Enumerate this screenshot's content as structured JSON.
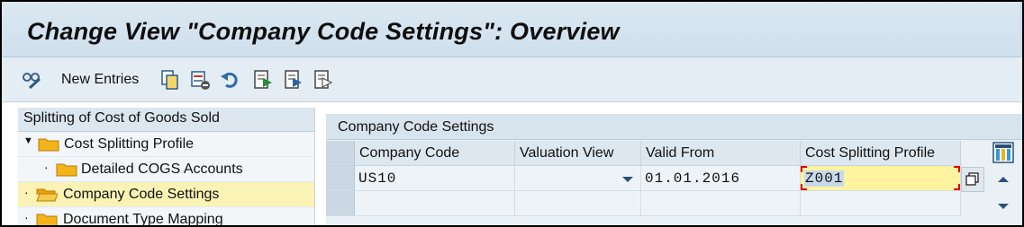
{
  "title": "Change View \"Company Code Settings\": Overview",
  "toolbar": {
    "new_entries_label": "New Entries"
  },
  "tree": {
    "header": "Splitting of Cost of Goods Sold",
    "items": [
      {
        "label": "Cost Splitting Profile",
        "expanded": true,
        "level": 0
      },
      {
        "label": "Detailed COGS Accounts",
        "level": 1
      },
      {
        "label": "Company Code Settings",
        "level": 0,
        "selected": true
      },
      {
        "label": "Document Type Mapping",
        "level": 0
      }
    ]
  },
  "table": {
    "title": "Company Code Settings",
    "columns": [
      "Company Code",
      "Valuation View",
      "Valid From",
      "Cost Splitting Profile"
    ],
    "rows": [
      {
        "company_code": "US10",
        "valuation_view": "",
        "valid_from": "01.01.2016",
        "profile": "Z001"
      }
    ]
  },
  "colors": {
    "title_bg": "#d4e3ef",
    "selection": "#fbf3b5",
    "focus_border": "#e00000"
  }
}
